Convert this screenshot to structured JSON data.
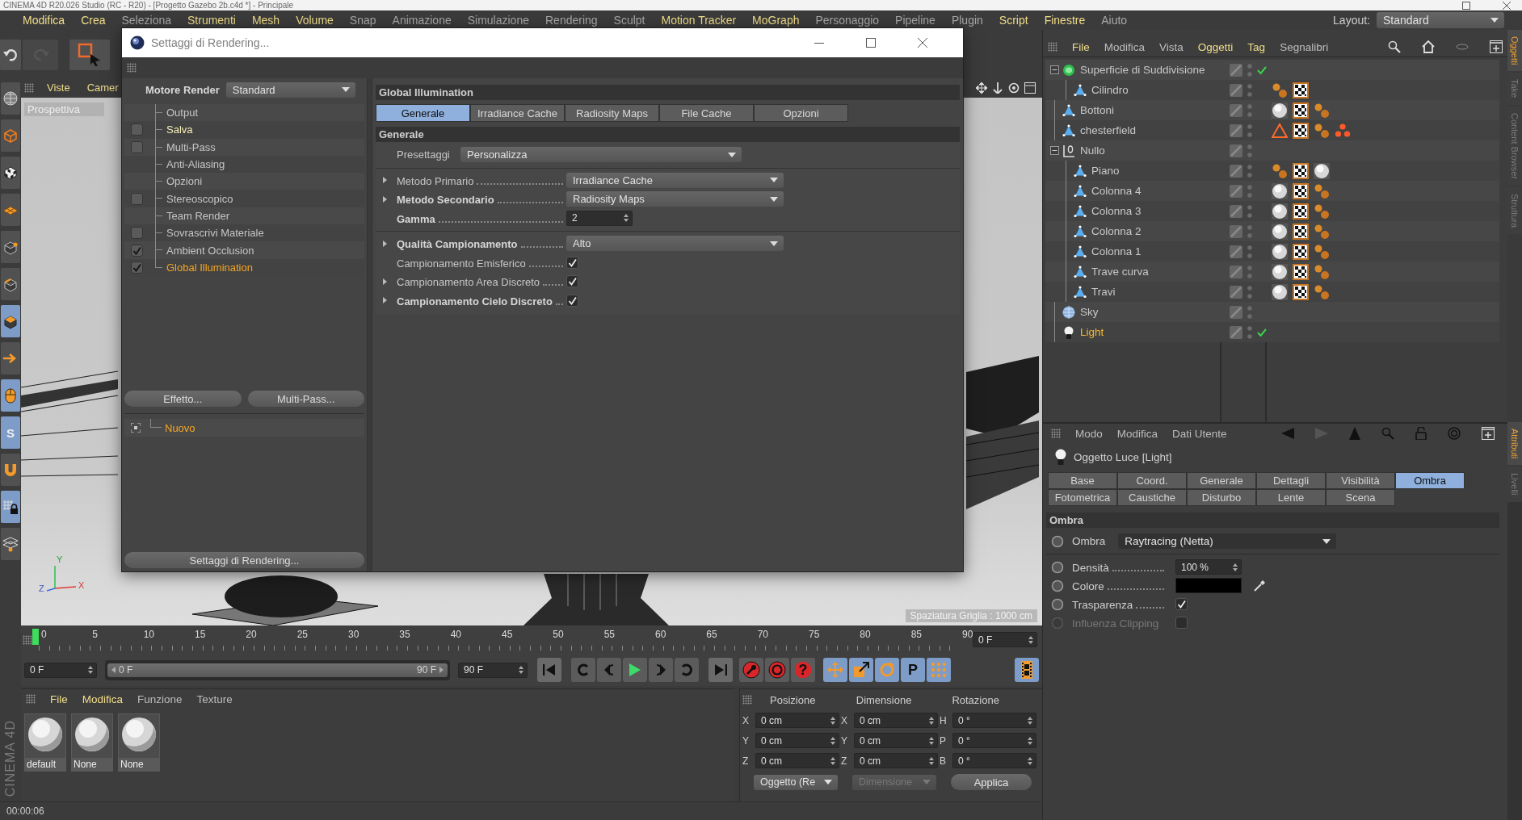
{
  "app": {
    "title": "CINEMA 4D R20.026 Studio (RC - R20) - [Progetto Gazebo 2b.c4d *] - Principale"
  },
  "menu": [
    {
      "label": "Modifica",
      "highlight": true
    },
    {
      "label": "Crea",
      "highlight": true
    },
    {
      "label": "Seleziona",
      "highlight": false
    },
    {
      "label": "Strumenti",
      "highlight": true
    },
    {
      "label": "Mesh",
      "highlight": true
    },
    {
      "label": "Volume",
      "highlight": true
    },
    {
      "label": "Snap",
      "highlight": false
    },
    {
      "label": "Animazione",
      "highlight": false
    },
    {
      "label": "Simulazione",
      "highlight": false
    },
    {
      "label": "Rendering",
      "highlight": false
    },
    {
      "label": "Sculpt",
      "highlight": false
    },
    {
      "label": "Motion Tracker",
      "highlight": true
    },
    {
      "label": "MoGraph",
      "highlight": true
    },
    {
      "label": "Personaggio",
      "highlight": false
    },
    {
      "label": "Pipeline",
      "highlight": false
    },
    {
      "label": "Plugin",
      "highlight": false
    },
    {
      "label": "Script",
      "highlight": true
    },
    {
      "label": "Finestre",
      "highlight": true
    },
    {
      "label": "Aiuto",
      "highlight": false
    }
  ],
  "layout": {
    "label": "Layout:",
    "value": "Standard"
  },
  "top_tools": [
    {
      "kind": "undo",
      "disabled": false
    },
    {
      "kind": "redo",
      "disabled": true
    },
    {
      "kind": "select",
      "disabled": false
    }
  ],
  "left_tools": [
    {
      "kind": "sphere",
      "selected": false
    },
    {
      "kind": "cube",
      "selected": false
    },
    {
      "kind": "checker",
      "selected": false
    },
    {
      "kind": "plane",
      "selected": false
    },
    {
      "kind": "point",
      "selected": false
    },
    {
      "kind": "edge",
      "selected": false
    },
    {
      "kind": "face",
      "selected": true
    },
    {
      "kind": "arrow",
      "selected": false
    },
    {
      "kind": "mouse",
      "selected": true
    },
    {
      "kind": "snap",
      "selected": true,
      "glyph": "S"
    },
    {
      "kind": "magnet",
      "selected": false
    },
    {
      "kind": "gridlock",
      "selected": true
    },
    {
      "kind": "grid",
      "selected": false
    }
  ],
  "brand": "CINEMA 4D",
  "viewport": {
    "menu": [
      "Viste",
      "Camer"
    ],
    "label": "Prospettiva",
    "axes": [
      "Y",
      "Z",
      "X"
    ],
    "grid_note": "Spaziatura Griglia : 1000 cm"
  },
  "render_settings": {
    "title": "Settaggi di Rendering...",
    "engine": {
      "label": "Motore Render",
      "value": "Standard"
    },
    "pages": [
      {
        "label": "Output",
        "kind": "page",
        "selected": false,
        "emphasized": false
      },
      {
        "label": "Salva",
        "kind": "toggle",
        "checked": false,
        "selected": false,
        "emphasized": true
      },
      {
        "label": "Multi-Pass",
        "kind": "toggle",
        "checked": false,
        "selected": false,
        "emphasized": false
      },
      {
        "label": "Anti-Aliasing",
        "kind": "page",
        "selected": false,
        "emphasized": false
      },
      {
        "label": "Opzioni",
        "kind": "page",
        "selected": false,
        "emphasized": false
      },
      {
        "label": "Stereoscopico",
        "kind": "toggle",
        "checked": false,
        "selected": false,
        "emphasized": false
      },
      {
        "label": "Team Render",
        "kind": "page",
        "selected": false,
        "emphasized": false
      },
      {
        "label": "Sovrascrivi Materiale",
        "kind": "toggle",
        "checked": false,
        "selected": false,
        "emphasized": false
      },
      {
        "label": "Ambient Occlusion",
        "kind": "toggle",
        "checked": true,
        "selected": false,
        "emphasized": false
      },
      {
        "label": "Global Illumination",
        "kind": "toggle",
        "checked": true,
        "selected": true,
        "emphasized": false
      }
    ],
    "buttons": [
      "Effetto...",
      "Multi-Pass..."
    ],
    "presets": [
      {
        "label": "Nuovo",
        "selected": true
      }
    ],
    "footer_button": "Settaggi di Rendering...",
    "panel": {
      "title": "Global Illumination",
      "tabs": [
        {
          "label": "Generale",
          "selected": true
        },
        {
          "label": "Irradiance Cache",
          "selected": false
        },
        {
          "label": "Radiosity Maps",
          "selected": false
        },
        {
          "label": "File Cache",
          "selected": false
        },
        {
          "label": "Opzioni",
          "selected": false
        }
      ],
      "section": "Generale",
      "preset": {
        "label": "Presettaggi",
        "value": "Personalizza"
      },
      "groups": [
        {
          "rows": [
            {
              "label": "Metodo Primario",
              "kind": "dropdown",
              "value": "Irradiance Cache",
              "expandable": true,
              "modified": false
            },
            {
              "label": "Metodo Secondario",
              "kind": "dropdown",
              "value": "Radiosity Maps",
              "expandable": true,
              "modified": true
            },
            {
              "label": "Gamma",
              "kind": "number",
              "value": "2",
              "expandable": false,
              "modified": true
            }
          ]
        },
        {
          "rows": [
            {
              "label": "Qualità Campionamento",
              "kind": "dropdown",
              "value": "Alto",
              "expandable": true,
              "modified": true
            },
            {
              "label": "Campionamento Emisferico",
              "kind": "checkbox",
              "checked": true,
              "expandable": false,
              "modified": false
            },
            {
              "label": "Campionamento Area Discreto",
              "kind": "checkbox",
              "checked": true,
              "expandable": true,
              "modified": false
            },
            {
              "label": "Campionamento Cielo Discreto",
              "kind": "checkbox",
              "checked": true,
              "expandable": true,
              "modified": true
            }
          ]
        }
      ]
    }
  },
  "object_manager": {
    "menu": [
      {
        "label": "File",
        "highlight": true
      },
      {
        "label": "Modifica",
        "highlight": false
      },
      {
        "label": "Vista",
        "highlight": false
      },
      {
        "label": "Oggetti",
        "highlight": true
      },
      {
        "label": "Tag",
        "highlight": true
      },
      {
        "label": "Segnalibri",
        "highlight": false
      }
    ],
    "objects": [
      {
        "name": "Superficie di Suddivisione",
        "kind": "subdivision",
        "expanded": true,
        "selected": false,
        "check": true,
        "children": [
          {
            "name": "Cilindro",
            "kind": "polygon",
            "selected": false,
            "check": false,
            "tags": [
              {
                "kind": "phong"
              },
              {
                "kind": "texture"
              }
            ]
          }
        ]
      },
      {
        "name": "Bottoni",
        "kind": "polygon",
        "selected": false,
        "check": false,
        "tags": [
          {
            "kind": "material"
          },
          {
            "kind": "texture"
          },
          {
            "kind": "phong"
          }
        ]
      },
      {
        "name": "chesterfield",
        "kind": "polygon",
        "selected": false,
        "check": false,
        "tags": [
          {
            "kind": "warning"
          },
          {
            "kind": "texture"
          },
          {
            "kind": "phong"
          },
          {
            "kind": "cluster"
          }
        ]
      },
      {
        "name": "Nullo",
        "kind": "null",
        "expanded": true,
        "selected": false,
        "check": false,
        "children": [
          {
            "name": "Piano",
            "kind": "polygon",
            "selected": false,
            "check": false,
            "tags": [
              {
                "kind": "phong"
              },
              {
                "kind": "texture"
              },
              {
                "kind": "material"
              }
            ]
          },
          {
            "name": "Colonna 4",
            "kind": "polygon",
            "selected": false,
            "check": false,
            "tags": [
              {
                "kind": "material"
              },
              {
                "kind": "texture"
              },
              {
                "kind": "phong"
              }
            ]
          },
          {
            "name": "Colonna 3",
            "kind": "polygon",
            "selected": false,
            "check": false,
            "tags": [
              {
                "kind": "material"
              },
              {
                "kind": "texture"
              },
              {
                "kind": "phong"
              }
            ]
          },
          {
            "name": "Colonna 2",
            "kind": "polygon",
            "selected": false,
            "check": false,
            "tags": [
              {
                "kind": "material"
              },
              {
                "kind": "texture"
              },
              {
                "kind": "phong"
              }
            ]
          },
          {
            "name": "Colonna 1",
            "kind": "polygon",
            "selected": false,
            "check": false,
            "tags": [
              {
                "kind": "material"
              },
              {
                "kind": "texture"
              },
              {
                "kind": "phong"
              }
            ]
          },
          {
            "name": "Trave curva",
            "kind": "polygon",
            "selected": false,
            "check": false,
            "tags": [
              {
                "kind": "material"
              },
              {
                "kind": "texture"
              },
              {
                "kind": "phong"
              }
            ]
          },
          {
            "name": "Travi",
            "kind": "polygon",
            "selected": false,
            "check": false,
            "tags": [
              {
                "kind": "material"
              },
              {
                "kind": "texture"
              },
              {
                "kind": "phong"
              }
            ]
          }
        ]
      },
      {
        "name": "Sky",
        "kind": "sky",
        "selected": false,
        "check": false
      },
      {
        "name": "Light",
        "kind": "light",
        "selected": true,
        "check": true
      }
    ]
  },
  "attributes": {
    "menu": [
      "Modo",
      "Modifica",
      "Dati Utente"
    ],
    "title": "Oggetto Luce [Light]",
    "tabs": [
      {
        "label": "Base",
        "selected": false
      },
      {
        "label": "Coord.",
        "selected": false
      },
      {
        "label": "Generale",
        "selected": false
      },
      {
        "label": "Dettagli",
        "selected": false
      },
      {
        "label": "Visibilità",
        "selected": false
      },
      {
        "label": "Ombra",
        "selected": true
      },
      {
        "label": "Fotometrica",
        "selected": false
      },
      {
        "label": "Caustiche",
        "selected": false
      },
      {
        "label": "Disturbo",
        "selected": false
      },
      {
        "label": "Lente",
        "selected": false
      },
      {
        "label": "Scena",
        "selected": false
      }
    ],
    "section": "Ombra",
    "mode": {
      "label": "Ombra",
      "value": "Raytracing (Netta)"
    },
    "params": [
      {
        "label": "Densità",
        "kind": "number",
        "value": "100 %",
        "disabled": false
      },
      {
        "label": "Colore",
        "kind": "color",
        "color": "#000000",
        "disabled": false
      },
      {
        "label": "Trasparenza",
        "kind": "checkbox",
        "checked": true,
        "disabled": false
      },
      {
        "label": "Influenza Clipping",
        "kind": "checkbox",
        "checked": false,
        "disabled": true
      }
    ]
  },
  "side_tabs": {
    "top": [
      {
        "label": "Oggetti",
        "selected": true
      },
      {
        "label": "Take",
        "selected": false
      },
      {
        "label": "Content Browser",
        "selected": false
      },
      {
        "label": "Struttura",
        "selected": false
      }
    ],
    "bottom": [
      {
        "label": "Attributi",
        "selected": true
      },
      {
        "label": "Livelli",
        "selected": false
      }
    ]
  },
  "timeline": {
    "ticks": [
      "0",
      "5",
      "10",
      "15",
      "20",
      "25",
      "30",
      "35",
      "40",
      "45",
      "50",
      "55",
      "60",
      "65",
      "70",
      "75",
      "80",
      "85",
      "90"
    ],
    "level": 0,
    "frame": "0 F",
    "start": "0 F",
    "range": {
      "start": "0 F",
      "end": "90 F",
      "level": 1
    },
    "end": "90 F",
    "help_glyph": "?",
    "tools": [
      {
        "kind": "move",
        "selected": true
      },
      {
        "kind": "scale",
        "selected": true
      },
      {
        "kind": "rotate",
        "selected": true
      },
      {
        "kind": "param",
        "selected": true,
        "glyph": "P"
      },
      {
        "kind": "points",
        "selected": true
      },
      {
        "kind": "film",
        "selected": true
      }
    ]
  },
  "materials": {
    "menu": [
      {
        "label": "File",
        "highlight": true
      },
      {
        "label": "Modifica",
        "highlight": true
      },
      {
        "label": "Funzione",
        "highlight": false
      },
      {
        "label": "Texture",
        "highlight": false
      }
    ],
    "items": [
      {
        "name": "default"
      },
      {
        "name": "None"
      },
      {
        "name": "None"
      }
    ]
  },
  "coordinates": {
    "headers": [
      "Posizione",
      "Dimensione",
      "Rotazione"
    ],
    "rows": [
      [
        {
          "axis": "X",
          "value": "0 cm"
        },
        {
          "axis": "X",
          "value": "0 cm"
        },
        {
          "axis": "H",
          "value": "0 °"
        }
      ],
      [
        {
          "axis": "Y",
          "value": "0 cm"
        },
        {
          "axis": "Y",
          "value": "0 cm"
        },
        {
          "axis": "P",
          "value": "0 °"
        }
      ],
      [
        {
          "axis": "Z",
          "value": "0 cm"
        },
        {
          "axis": "Z",
          "value": "0 cm"
        },
        {
          "axis": "B",
          "value": "0 °"
        }
      ]
    ],
    "mode": {
      "label": "Oggetto (Re",
      "disabled": false
    },
    "size_mode": {
      "label": "Dimensione",
      "disabled": true
    },
    "apply": "Applica"
  },
  "status": "00:00:06"
}
